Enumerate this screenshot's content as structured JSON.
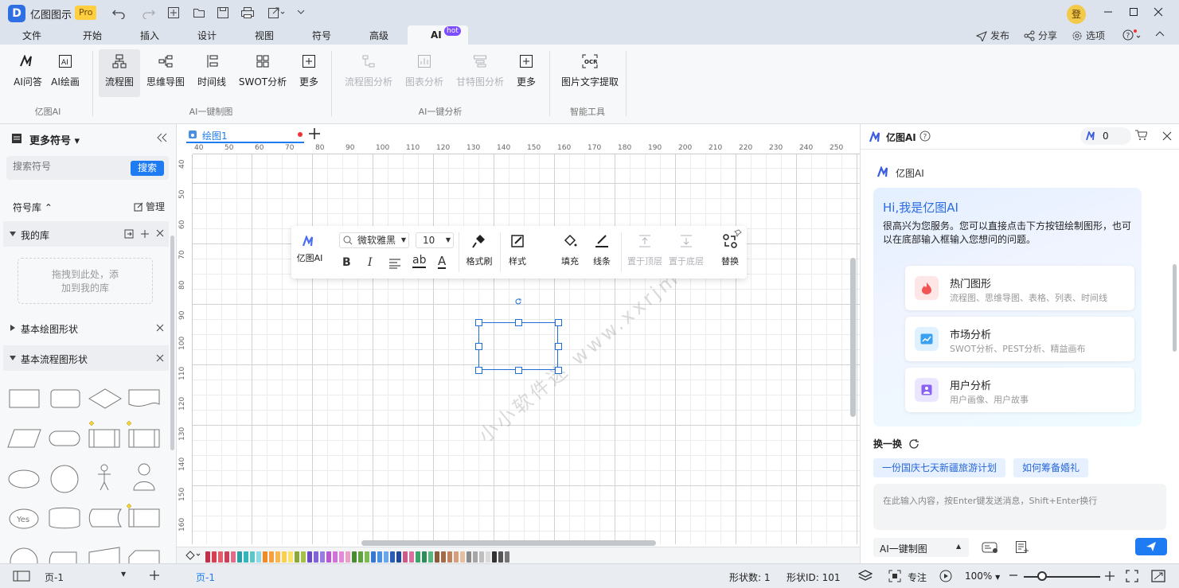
{
  "app": {
    "title": "亿图图示",
    "badge": "Pro",
    "avatar_text": "登"
  },
  "menu": {
    "tabs": [
      "文件",
      "开始",
      "插入",
      "设计",
      "视图",
      "符号",
      "高级",
      "AI"
    ],
    "ai_badge": "hot",
    "right": {
      "publish": "发布",
      "share": "分享",
      "options": "选项"
    }
  },
  "ribbon": {
    "groups": [
      {
        "label": "亿图AI",
        "buttons": [
          "AI问答",
          "AI绘画"
        ]
      },
      {
        "label": "AI一键制图",
        "buttons": [
          "流程图",
          "思维导图",
          "时间线",
          "SWOT分析",
          "更多"
        ]
      },
      {
        "label": "AI一键分析",
        "buttons": [
          "流程图分析",
          "图表分析",
          "甘特图分析",
          "更多"
        ]
      },
      {
        "label": "智能工具",
        "buttons": [
          "图片文字提取"
        ]
      }
    ]
  },
  "left": {
    "title": "更多符号",
    "search_placeholder": "搜索符号",
    "search_button": "搜索",
    "library_label": "符号库",
    "manage": "管理",
    "my_library": "我的库",
    "drop_hint_1": "拖拽到此处，添",
    "drop_hint_2": "加到我的库",
    "basic_shapes": "基本绘图形状",
    "basic_flow": "基本流程图形状",
    "yes_label": "Yes"
  },
  "doc": {
    "tab": "绘图1"
  },
  "ruler": {
    "h": [
      "40",
      "50",
      "60",
      "70",
      "80",
      "90",
      "100",
      "110",
      "120",
      "130",
      "140",
      "150",
      "160",
      "170",
      "180",
      "190",
      "200",
      "210",
      "220",
      "230",
      "240",
      "250"
    ],
    "v": [
      "40",
      "50",
      "60",
      "70",
      "80",
      "90",
      "100",
      "110",
      "120",
      "130",
      "140",
      "150",
      "160"
    ]
  },
  "float_toolbar": {
    "ai": "亿图AI",
    "font": "微软雅黑",
    "size": "10",
    "format_brush": "格式刷",
    "style": "样式",
    "fill": "填充",
    "line": "线条",
    "to_top": "置于顶层",
    "to_bottom": "置于底层",
    "replace": "替换"
  },
  "watermark": "小小软件迷 www.xxrjm.com",
  "ai": {
    "title": "亿图AI",
    "credits": "0",
    "section_label": "亿图AI",
    "greeting": "Hi,我是亿图AI",
    "intro": "很高兴为您服务。您可以直接点击下方按钮绘制图形，也可以在底部输入框输入您想问的问题。",
    "cards": [
      {
        "title": "热门图形",
        "sub": "流程图、思维导图、表格、列表、时间线"
      },
      {
        "title": "市场分析",
        "sub": "SWOT分析、PEST分析、精益画布"
      },
      {
        "title": "用户分析",
        "sub": "用户画像、用户故事"
      }
    ],
    "refresh": "换一换",
    "suggestions": [
      "一份国庆七天新疆旅游计划",
      "如何筹备婚礼"
    ],
    "input_placeholder": "在此输入内容，按Enter键发送消息，Shift+Enter换行",
    "mode": "AI一键制图"
  },
  "status": {
    "page_sel": "页-1",
    "page_tab": "页-1",
    "shape_count": "形状数: 1",
    "shape_id": "形状ID: 101",
    "focus": "专注",
    "zoom": "100%"
  },
  "palette": [
    "#c0304a",
    "#d64052",
    "#e25d6c",
    "#c8405c",
    "#e06d8a",
    "#2b9fa8",
    "#34b5b8",
    "#5cc7c9",
    "#8fd8e4",
    "#f08a24",
    "#f5a03c",
    "#f7b94f",
    "#f9d04e",
    "#fbe36b",
    "#8ba838",
    "#a4c045",
    "#6a4bc4",
    "#8262d6",
    "#9a7be0",
    "#b85acd",
    "#cf73da",
    "#e08ad8",
    "#ea9fc6",
    "#4a8a30",
    "#5fa040",
    "#7dba55",
    "#3678d1",
    "#4a8fe0",
    "#6aa7ea",
    "#2c5db6",
    "#1f4a99",
    "#c95a8a",
    "#d96f9e",
    "#3aa46a",
    "#2f8b58",
    "#5ab580",
    "#8b5a3c",
    "#a36c48",
    "#c08360",
    "#d59e7c",
    "#e4c0a0",
    "#8c8c8c",
    "#a6a6a6",
    "#bfbfbf",
    "#d9d9d9",
    "#333333",
    "#555555",
    "#777777"
  ]
}
